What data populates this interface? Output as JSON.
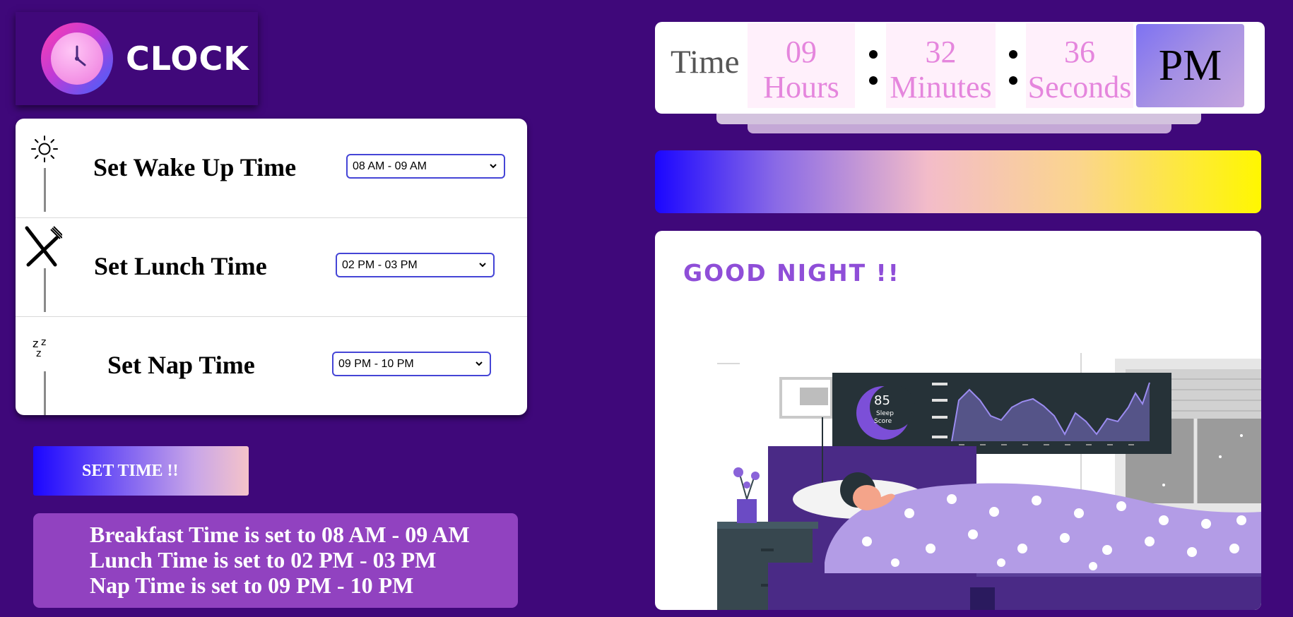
{
  "logo": {
    "text": "CLOCK"
  },
  "schedule": [
    {
      "label": "Set Wake Up Time",
      "selected": "08 AM - 09 AM",
      "icon": "sun-icon"
    },
    {
      "label": "Set Lunch Time",
      "selected": "02 PM - 03 PM",
      "icon": "fork-knife-icon"
    },
    {
      "label": "Set Nap Time",
      "selected": "09 PM - 10 PM",
      "icon": "zzz-icon"
    }
  ],
  "set_button": {
    "label": "SET TIME !!"
  },
  "summary": [
    "Breakfast Time is set to 08 AM - 09 AM",
    "Lunch Time is set to 02 PM - 03 PM",
    "Nap Time is set to 09 PM - 10 PM"
  ],
  "clock": {
    "label": "Time",
    "hours": "09",
    "hours_label": "Hours",
    "minutes": "32",
    "minutes_label": "Minutes",
    "seconds": "36",
    "seconds_label": "Seconds",
    "ampm": "PM"
  },
  "illustration": {
    "title": "GOOD NIGHT !!",
    "sleep_score": "85",
    "sleep_score_line1": "Sleep",
    "sleep_score_line2": "Score"
  },
  "colors": {
    "background": "#3f087a",
    "accent_blue": "#1b06ff",
    "accent_yellow": "#fff700",
    "summary_bg": "#9142c0",
    "clock_digits": "#e586dd"
  }
}
